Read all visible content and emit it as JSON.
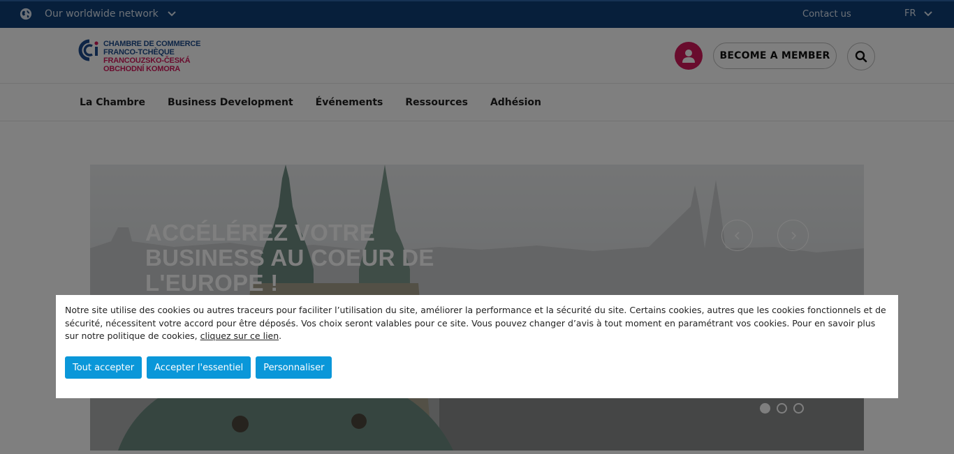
{
  "topbar": {
    "network_label": "Our worldwide network",
    "contact_label": "Contact us",
    "language": "FR",
    "icons": {
      "globe": "globe-icon",
      "chevron": "chevron-down-icon"
    }
  },
  "header": {
    "logo": {
      "line1": "CHAMBRE DE COMMERCE",
      "line2": "FRANCO-TCHÈQUE",
      "line3": "FRANCOUZSKO-ČESKÁ",
      "line4": "OBCHODNÍ KOMORA"
    },
    "member_button": "BECOME A MEMBER",
    "icons": {
      "user": "user-icon",
      "search": "search-icon"
    }
  },
  "nav": {
    "items": [
      "La Chambre",
      "Business Development",
      "Événements",
      "Ressources",
      "Adhésion"
    ]
  },
  "hero": {
    "title": "Accélérez votre business au coeur de l'Europe !",
    "slide_count": 3,
    "active_slide": 1
  },
  "cookie": {
    "text": "Notre site utilise des cookies ou autres traceurs pour faciliter l’utilisation du site, améliorer la performance et la sécurité du site. Certains cookies, autres que les cookies fonctionnels et de sécurité, nécessitent votre accord pour être déposés. Vos choix seront valables pour ce site. Vous pouvez changer d’avis à tout moment en paramétrant vos cookies. Pour en savoir plus sur notre politique de cookies, ",
    "link": "cliquez sur ce lien",
    "text_end": ".",
    "buttons": {
      "accept_all": "Tout accepter",
      "accept_essential": "Accepter l'essentiel",
      "customize": "Personnaliser"
    }
  },
  "colors": {
    "topbar": "#0f3f77",
    "brand_pink": "#d3185b",
    "brand_blue": "#1c4b8c",
    "cookie_button": "#0a97d9"
  }
}
